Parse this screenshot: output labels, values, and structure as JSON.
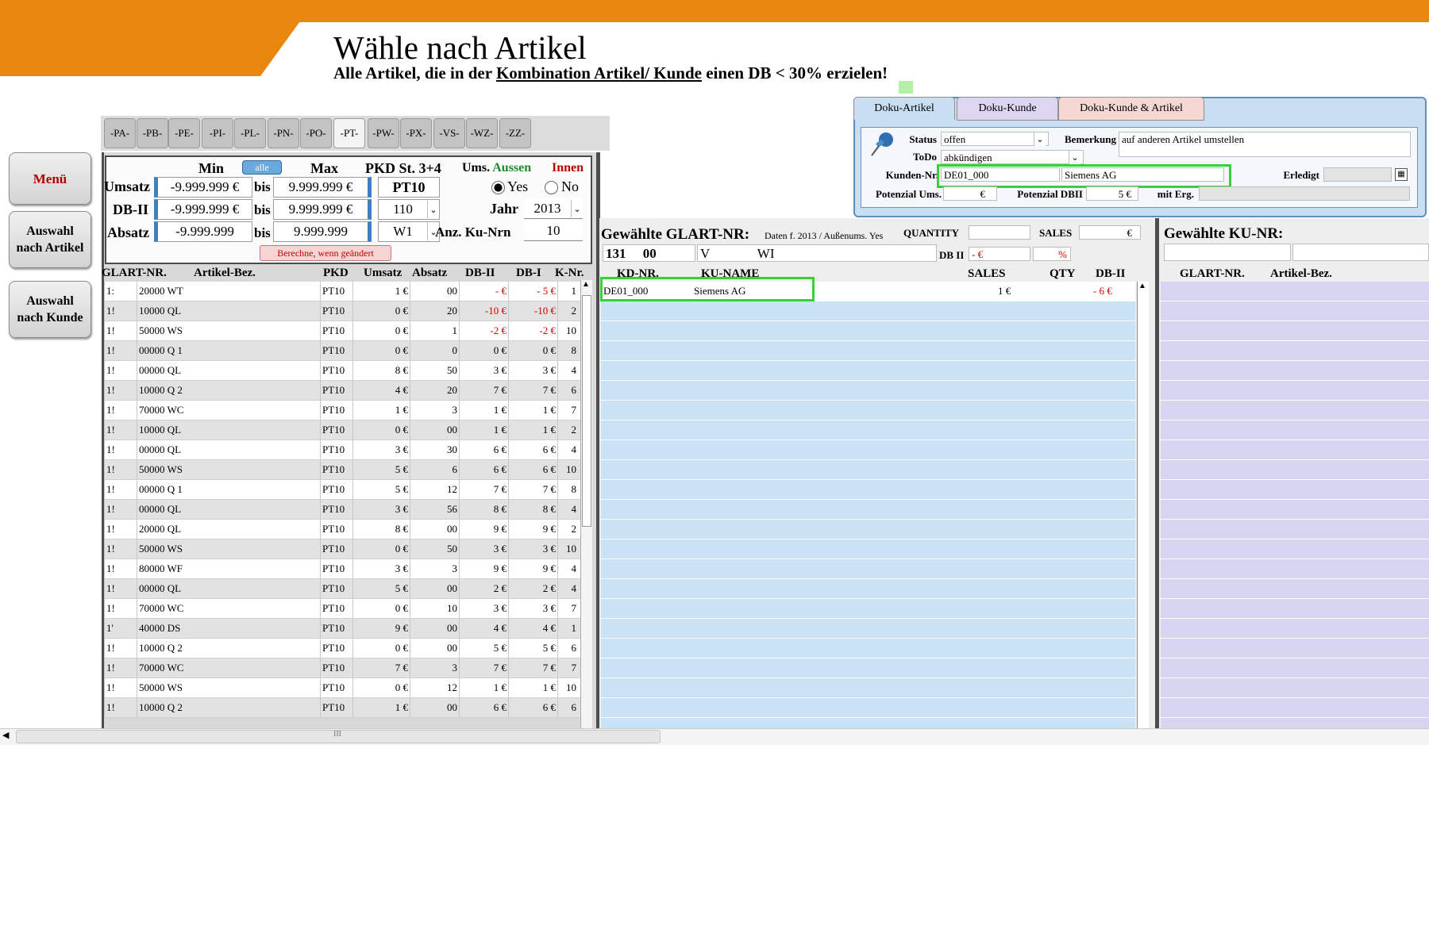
{
  "colors": {
    "accent": "#e8870e",
    "navy": "#3d7fc1",
    "negative": "#d40000",
    "highlight": "#37cf3a"
  },
  "header": {
    "title": "Wähle nach Artikel",
    "subtitle_prefix": "Alle Artikel, die in der ",
    "subtitle_link": "Kombination Artikel/ Kunde",
    "subtitle_suffix": " einen DB < 30% erzielen!"
  },
  "nav": {
    "menu": "Menü",
    "by_article": "Auswahl\nnach Artikel",
    "by_customer": "Auswahl\nnach Kunde"
  },
  "pkd_tabs": [
    "-PA-",
    "-PB-",
    "-PE-",
    "-PI-",
    "-PL-",
    "-PN-",
    "-PO-",
    "-PT-",
    "-PW-",
    "-PX-",
    "-VS-",
    "-WZ-",
    "-ZZ-"
  ],
  "active_tab": "-PT-",
  "filters": {
    "min_label": "Min",
    "alle_label": "alle",
    "max_label": "Max",
    "pkd_label": "PKD St. 3+4",
    "ums_label": "Ums.",
    "aussen_label": "Aussen",
    "innen_label": "Innen",
    "umsatz_label": "Umsatz",
    "umsatz_min": "-9.999.999 €",
    "umsatz_max": "9.999.999 €",
    "dbii_label": "DB-II",
    "dbii_min": "-9.999.999 €",
    "dbii_max": "9.999.999 €",
    "absatz_label": "Absatz",
    "absatz_min": "-9.999.999",
    "absatz_max": "9.999.999",
    "bis": "bis",
    "pkd_value": "PT10",
    "code_value": "110",
    "w_value": "W1",
    "yes_label": "Yes",
    "no_label": "No",
    "jahr_label": "Jahr",
    "jahr_value": "2013",
    "anz_label": "Anz. Ku-Nrn",
    "anz_value": "10",
    "berechne": "Berechne, wenn geändert"
  },
  "left_table": {
    "headers": [
      "GLART-NR.",
      "Artikel-Bez.",
      "PKD",
      "Umsatz",
      "Absatz",
      "DB-II",
      "DB-I",
      "K-Nr."
    ],
    "rows": [
      [
        "1:",
        "20000 WT",
        "PT10",
        "1 €",
        "00",
        "-     €",
        "-    5 €",
        "1"
      ],
      [
        "1!",
        "10000 QL",
        "PT10",
        "0 €",
        "20",
        "-10 €",
        "-10 €",
        "2"
      ],
      [
        "1!",
        "50000 WS",
        "PT10",
        "0 €",
        "1",
        "-2 €",
        "-2 €",
        "10"
      ],
      [
        "1!",
        "00000 Q 1",
        "PT10",
        "0 €",
        "0",
        "0 €",
        "0 €",
        "8"
      ],
      [
        "1!",
        "00000 QL",
        "PT10",
        "8 €",
        "50",
        "3 €",
        "3 €",
        "4"
      ],
      [
        "1!",
        "10000 Q 2",
        "PT10",
        "4 €",
        "20",
        "7 €",
        "7 €",
        "6"
      ],
      [
        "1!",
        "70000 WC",
        "PT10",
        "1 €",
        "3",
        "1 €",
        "1 €",
        "7"
      ],
      [
        "1!",
        "10000 QL",
        "PT10",
        "0 €",
        "00",
        "1 €",
        "1 €",
        "2"
      ],
      [
        "1!",
        "00000 QL",
        "PT10",
        "3 €",
        "30",
        "6 €",
        "6 €",
        "4"
      ],
      [
        "1!",
        "50000 WS",
        "PT10",
        "5 €",
        "6",
        "6 €",
        "6 €",
        "10"
      ],
      [
        "1!",
        "00000 Q 1",
        "PT10",
        "5 €",
        "12",
        "7 €",
        "7 €",
        "8"
      ],
      [
        "1!",
        "00000 QL",
        "PT10",
        "3 €",
        "56",
        "8 €",
        "8 €",
        "4"
      ],
      [
        "1!",
        "20000 QL",
        "PT10",
        "8 €",
        "00",
        "9 €",
        "9 €",
        "2"
      ],
      [
        "1!",
        "50000 WS",
        "PT10",
        "0 €",
        "50",
        "3 €",
        "3 €",
        "10"
      ],
      [
        "1!",
        "80000 WF",
        "PT10",
        "3 €",
        "3",
        "9 €",
        "9 €",
        "4"
      ],
      [
        "1!",
        "00000 QL",
        "PT10",
        "5 €",
        "00",
        "2 €",
        "2 €",
        "4"
      ],
      [
        "1!",
        "70000 WC",
        "PT10",
        "0 €",
        "10",
        "3 €",
        "3 €",
        "7"
      ],
      [
        "1'",
        "40000 DS",
        "PT10",
        "9 €",
        "00",
        "4 €",
        "4 €",
        "1"
      ],
      [
        "1!",
        "10000 Q 2",
        "PT10",
        "0 €",
        "00",
        "5 €",
        "5 €",
        "6"
      ],
      [
        "1!",
        "70000 WC",
        "PT10",
        "7 €",
        "3",
        "7 €",
        "7 €",
        "7"
      ],
      [
        "1!",
        "50000 WS",
        "PT10",
        "0 €",
        "12",
        "1 €",
        "1 €",
        "10"
      ],
      [
        "1!",
        "10000 Q 2",
        "PT10",
        "1 €",
        "00",
        "6 €",
        "6 €",
        "6"
      ]
    ]
  },
  "mid": {
    "title": "Gewählte GLART-NR:",
    "daten": "Daten f. 2013 / Außenums. Yes",
    "quantity_label": "QUANTITY",
    "sales_label": "SALES",
    "sales_unit": "€",
    "glart_value": "131",
    "glart_value2": "00",
    "desc_value": "V",
    "desc_value2": "WI",
    "dbii_label": "DB II",
    "dbii_value": "-      €",
    "dbii_pct": "%",
    "headers": [
      "KD-NR.",
      "KU-NAME",
      "SALES",
      "QTY",
      "DB-II"
    ],
    "row": {
      "kdnr": "DE01_000",
      "name": "Siemens AG",
      "sales": "1     €",
      "qty": "",
      "dbii": "-        6 €"
    }
  },
  "right": {
    "title": "Gewählte KU-NR:",
    "headers": [
      "GLART-NR.",
      "Artikel-Bez."
    ]
  },
  "doku": {
    "tabs": [
      "Doku-Artikel",
      "Doku-Kunde",
      "Doku-Kunde & Artikel"
    ],
    "status_label": "Status",
    "status_value": "offen",
    "bemerkung_label": "Bemerkung",
    "bemerkung_value": "auf anderen Artikel umstellen",
    "todo_label": "ToDo",
    "todo_value": "abkündigen",
    "kunden_label": "Kunden-Nr.",
    "kunden_value": "DE01_000",
    "kunden_name": "Siemens AG",
    "erledigt_label": "Erledigt",
    "pot_ums_label": "Potenzial Ums.",
    "pot_ums_value": "€",
    "pot_dbii_label": "Potenzial DBII",
    "pot_dbii_value": "5 €",
    "mit_erg_label": "mit Erg."
  },
  "scroll": {
    "thumb_grip": "III"
  }
}
